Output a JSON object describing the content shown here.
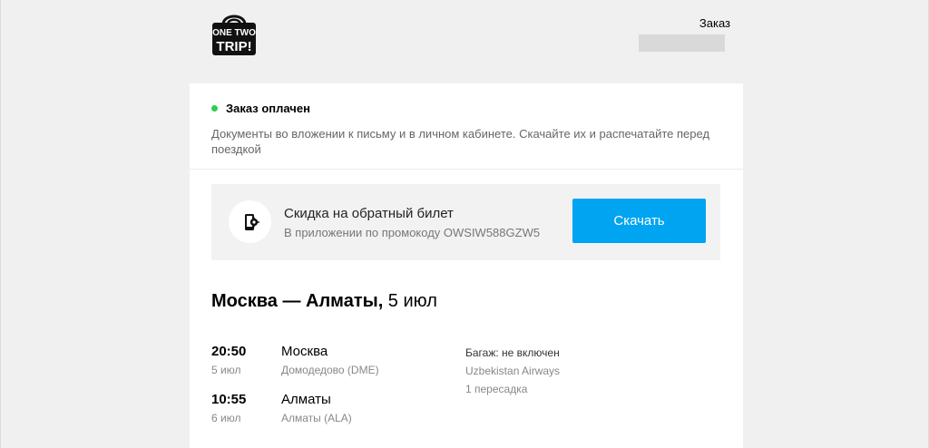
{
  "header": {
    "logo_text_line1": "ONE TWO",
    "logo_text_line2": "TRIP!",
    "order_label": "Заказ"
  },
  "status": {
    "title": "Заказ оплачен",
    "description": "Документы во вложении к письму и в личном кабинете. Скачайте их и распечатайте перед поездкой",
    "color": "#2ecc56"
  },
  "promo": {
    "icon": "phone-gear-icon",
    "title": "Скидка на обратный билет",
    "subtitle": "В приложении по промокоду OWSIW588GZW5",
    "button_label": "Скачать",
    "button_color": "#00a4f0"
  },
  "route": {
    "cities": "Москва — Алматы,",
    "date": " 5 июл",
    "departure": {
      "time": "20:50",
      "date": "5 июл",
      "city": "Москва",
      "airport": "Домодедово (DME)"
    },
    "arrival": {
      "time": "10:55",
      "date": "6 июл",
      "city": "Алматы",
      "airport": "Алматы (ALA)"
    },
    "baggage": "Багаж: не включен",
    "airline": "Uzbekistan Airways",
    "stops": "1 пересадка"
  }
}
